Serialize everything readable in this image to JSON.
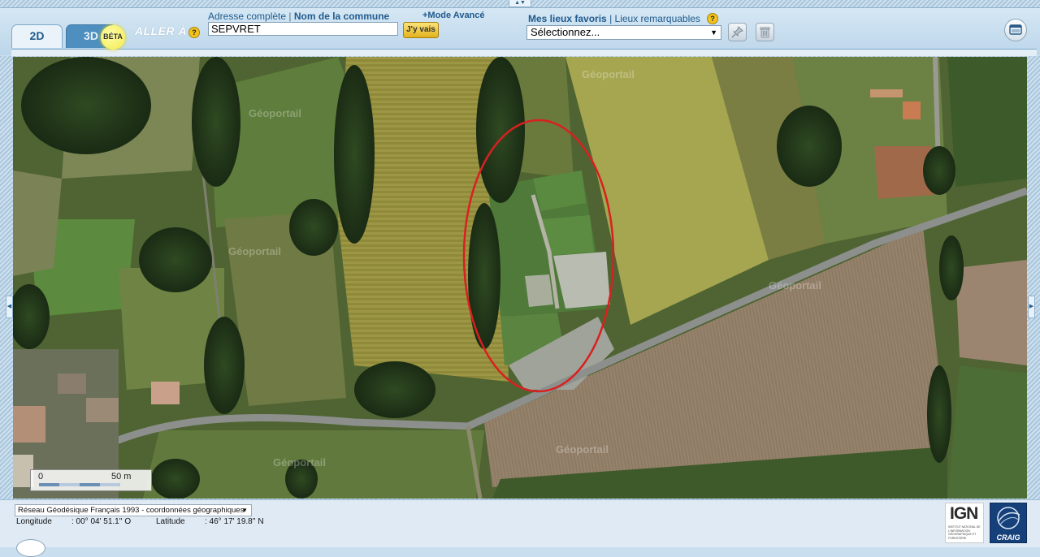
{
  "toolbar": {
    "tab_2d": "2D",
    "tab_3d": "3D",
    "beta_badge": "BÉTA",
    "goto_label": "ALLER À",
    "help_glyph": "?",
    "address": {
      "label_full": "Adresse complète",
      "separator": "|",
      "label_commune": "Nom de la commune",
      "value": "SEPVRET",
      "go_button": "J'y vais",
      "advanced_mode": "+Mode Avancé"
    },
    "favorites": {
      "label_favorites": "Mes lieux favoris",
      "separator": "|",
      "label_remarkable": "Lieux remarquables",
      "select_value": "Sélectionnez..."
    }
  },
  "icons": {
    "pin": "pin-icon",
    "trash": "trash-icon",
    "window": "window-icon"
  },
  "map": {
    "watermark": "Géoportail",
    "scale": {
      "zero": "0",
      "distance": "50 m"
    },
    "highlight_color": "#d92020"
  },
  "footer": {
    "crs_select": "Réseau Géodésique Français 1993 - coordonnées géographiques",
    "longitude_label": "Longitude",
    "longitude_value": ": 00° 04' 51.1'' O",
    "latitude_label": "Latitude",
    "latitude_value": ": 46° 17' 19.8'' N",
    "logo_ign": "IGN",
    "logo_ign_sub": "INSTITUT NATIONAL DE L'INFORMATION GÉOGRAPHIQUE ET FORESTIÈRE",
    "logo_craig": "CRAIG"
  },
  "colors": {
    "accent": "#1f5a8c",
    "toolbar_bg": "#c9dff0",
    "go_button": "#f0c53a"
  }
}
